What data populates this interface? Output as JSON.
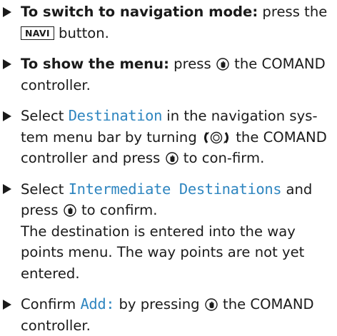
{
  "steps": [
    {
      "bold_label": "To switch to navigation mode:",
      "text_a": " press the ",
      "key_label": "NAVI",
      "text_b": " button."
    },
    {
      "bold_label": "To show the menu:",
      "text_a": " press ",
      "text_b": " the COMAND controller."
    },
    {
      "text_a": "Select ",
      "display_term": "Destination",
      "text_b": " in the navigation sys-tem menu bar by turning ",
      "text_c": " the COMAND controller and press ",
      "text_d": " to con-firm."
    },
    {
      "text_a": "Select ",
      "display_term": "Intermediate Destinations",
      "text_b": " and press ",
      "text_c": " to confirm.",
      "result_text": "The destination is entered into the way points menu. The way points are not yet entered."
    },
    {
      "text_a": "Confirm ",
      "display_term": "Add:",
      "text_b": " by pressing ",
      "text_c": " the COMAND controller."
    }
  ],
  "icons": {
    "step_marker": "triangle-right-icon",
    "press": "controller-press-icon",
    "turn": "controller-turn-icon"
  },
  "colors": {
    "text": "#1a1a1a",
    "display_term": "#2f86c0"
  }
}
